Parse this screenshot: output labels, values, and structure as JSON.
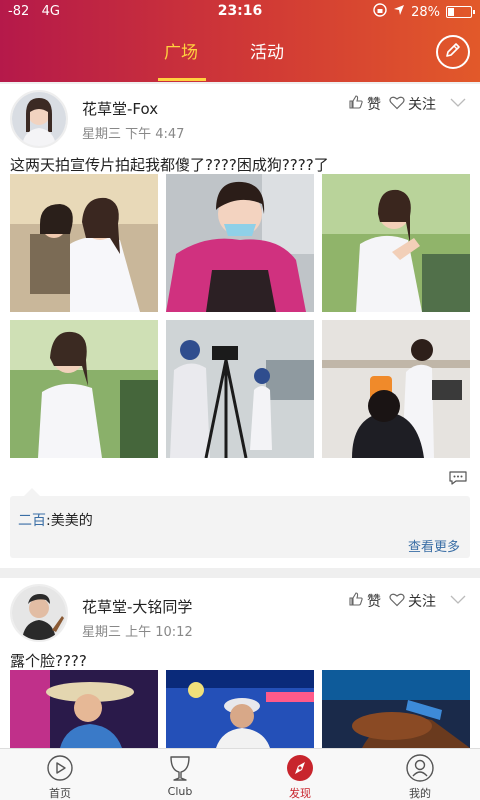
{
  "status_bar": {
    "signal": "-82",
    "network": "4G",
    "time": "23:16",
    "battery": "28%",
    "battery_level": 0.28
  },
  "header": {
    "tabs": [
      {
        "label": "广场",
        "active": true
      },
      {
        "label": "活动",
        "active": false
      }
    ],
    "edit_icon": "pencil-icon"
  },
  "posts": [
    {
      "user": "花草堂-Fox",
      "time": "星期三 下午 4:47",
      "like_label": "赞",
      "follow_label": "关注",
      "caption": "这两天拍宣传片拍起我都傻了????困成狗????了",
      "comment": {
        "user": "二百",
        "text": ":美美的"
      },
      "more_label": "查看更多"
    },
    {
      "user": "花草堂-大铭同学",
      "time": "星期三 上午 10:12",
      "like_label": "赞",
      "follow_label": "关注",
      "caption": "露个脸????"
    }
  ],
  "bottom_nav": [
    {
      "label": "首页",
      "icon": "play-circle-icon",
      "active": false
    },
    {
      "label": "Club",
      "icon": "cup-icon",
      "active": false
    },
    {
      "label": "发现",
      "icon": "compass-icon",
      "active": true
    },
    {
      "label": "我的",
      "icon": "user-icon",
      "active": false
    }
  ],
  "colors": {
    "accent": "#c8252d",
    "tab_active": "#ffd23f",
    "link": "#3a6ea5"
  }
}
